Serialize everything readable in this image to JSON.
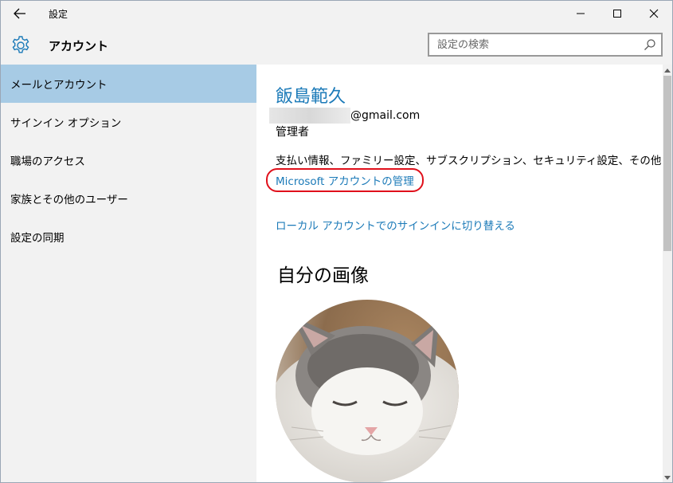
{
  "window": {
    "title": "設定"
  },
  "header": {
    "title": "アカウント",
    "search_placeholder": "設定の検索"
  },
  "sidebar": {
    "items": [
      {
        "label": "メールとアカウント",
        "selected": true
      },
      {
        "label": "サインイン オプション",
        "selected": false
      },
      {
        "label": "職場のアクセス",
        "selected": false
      },
      {
        "label": "家族とその他のユーザー",
        "selected": false
      },
      {
        "label": "設定の同期",
        "selected": false
      }
    ]
  },
  "account": {
    "name": "飯島範久",
    "email_suffix": "@gmail.com",
    "role": "管理者",
    "billing_text": "支払い情報、ファミリー設定、サブスクリプション、セキュリティ設定、その他",
    "manage_link": "Microsoft アカウントの管理",
    "local_link": "ローカル アカウントでのサインインに切り替える",
    "picture_heading": "自分の画像"
  },
  "colors": {
    "accent": "#1b7ab8",
    "selected_nav": "#a7cbe5",
    "sidebar_bg": "#f2f2f2",
    "highlight_ring": "#e0101b"
  }
}
